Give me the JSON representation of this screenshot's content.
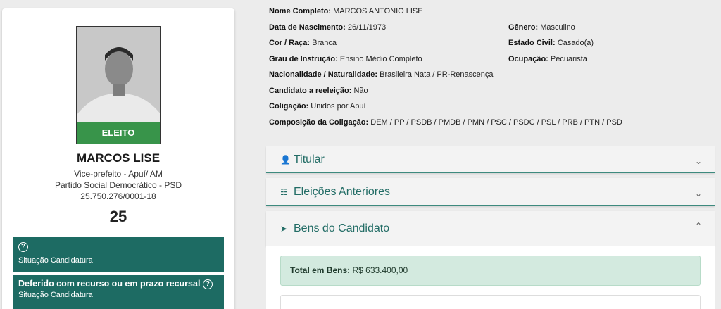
{
  "candidate": {
    "status_label": "ELEITO",
    "name": "MARCOS LISE",
    "role": "Vice-prefeito - Apuí/ AM",
    "party": "Partido Social Democrático - PSD",
    "cnpj": "25.750.276/0001-18",
    "number": "25"
  },
  "status_boxes": [
    {
      "title": "",
      "subtitle": "Situação Candidato"
    },
    {
      "title": "Deferido com recurso ou em prazo recursal",
      "subtitle": "Situação Candidatura"
    }
  ],
  "details": {
    "nome_label": "Nome Completo:",
    "nome": "MARCOS ANTONIO LISE",
    "nasc_label": "Data de Nascimento:",
    "nasc": "26/11/1973",
    "genero_label": "Gênero:",
    "genero": "Masculino",
    "cor_label": "Cor / Raça:",
    "cor": "Branca",
    "civil_label": "Estado Civil:",
    "civil": "Casado(a)",
    "grau_label": "Grau de Instrução:",
    "grau": "Ensino Médio Completo",
    "ocup_label": "Ocupação:",
    "ocup": "Pecuarista",
    "nac_label": "Nacionalidade / Naturalidade:",
    "nac": "Brasileira Nata / PR-Renascença",
    "reel_label": "Candidato a reeleição:",
    "reel": "Não",
    "colig_label": "Coligação:",
    "colig": "Unidos por Apuí",
    "comp_label": "Composição da Coligação:",
    "comp": "DEM / PP / PSDB / PMDB / PMN / PSC / PSDC / PSL / PRB / PTN / PSD"
  },
  "panels": {
    "titular": "Titular",
    "eleicoes": "Eleições Anteriores",
    "bens": "Bens do Candidato"
  },
  "bens": {
    "total_label": "Total em Bens:",
    "total_value": "R$ 633.400,00"
  },
  "icons": {
    "titular": "user-icon",
    "eleicoes": "sitemap-icon",
    "bens": "rocket-icon"
  },
  "colors": {
    "accent": "#1d6b63",
    "elected": "#288c3c",
    "total_bg": "#d3eadf"
  }
}
